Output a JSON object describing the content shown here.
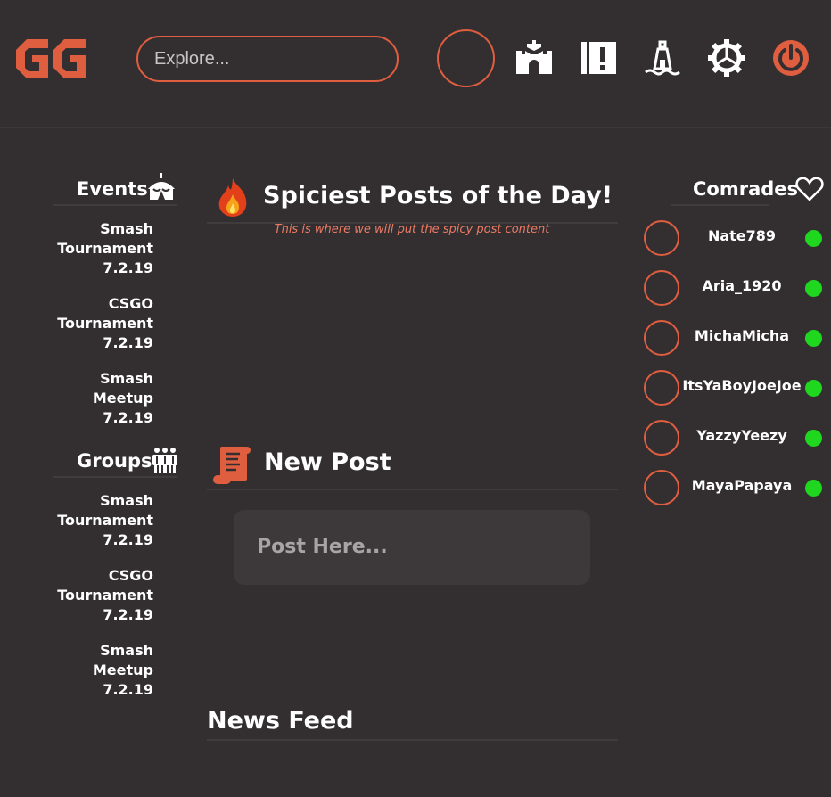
{
  "header": {
    "logo_text": "GG",
    "search": {
      "placeholder": "Explore..."
    },
    "nav_icons": [
      "home-castle-icon",
      "alert-book-icon",
      "lighthouse-icon",
      "settings-gear-icon",
      "power-icon"
    ]
  },
  "left": {
    "events_title": "Events",
    "events": [
      {
        "line1": "Smash",
        "line2": "Tournament",
        "date": "7.2.19"
      },
      {
        "line1": "CSGO",
        "line2": "Tournament",
        "date": "7.2.19"
      },
      {
        "line1": "Smash",
        "line2": "Meetup",
        "date": "7.2.19"
      }
    ],
    "groups_title": "Groups",
    "groups": [
      {
        "line1": "Smash",
        "line2": "Tournament",
        "date": "7.2.19"
      },
      {
        "line1": "CSGO",
        "line2": "Tournament",
        "date": "7.2.19"
      },
      {
        "line1": "Smash",
        "line2": "Meetup",
        "date": "7.2.19"
      }
    ]
  },
  "center": {
    "spicy_title": "Spiciest Posts of the Day!",
    "spicy_subtitle": "This is where we will put the spicy post content",
    "new_post_title": "New Post",
    "post_placeholder": "Post Here...",
    "news_feed_title": "News Feed"
  },
  "right": {
    "comrades_title": "Comrades",
    "comrades": [
      {
        "name": "Nate789",
        "status": "online"
      },
      {
        "name": "Aria_1920",
        "status": "online"
      },
      {
        "name": "MichaMicha",
        "status": "online"
      },
      {
        "name": "ItsYaBoyJoeJoe",
        "status": "online"
      },
      {
        "name": "YazzyYeezy",
        "status": "online"
      },
      {
        "name": "MayaPapaya",
        "status": "online"
      }
    ]
  },
  "colors": {
    "accent": "#e05e40",
    "background": "#332f31",
    "online": "#1fd71f",
    "post_box": "#3d393b"
  }
}
